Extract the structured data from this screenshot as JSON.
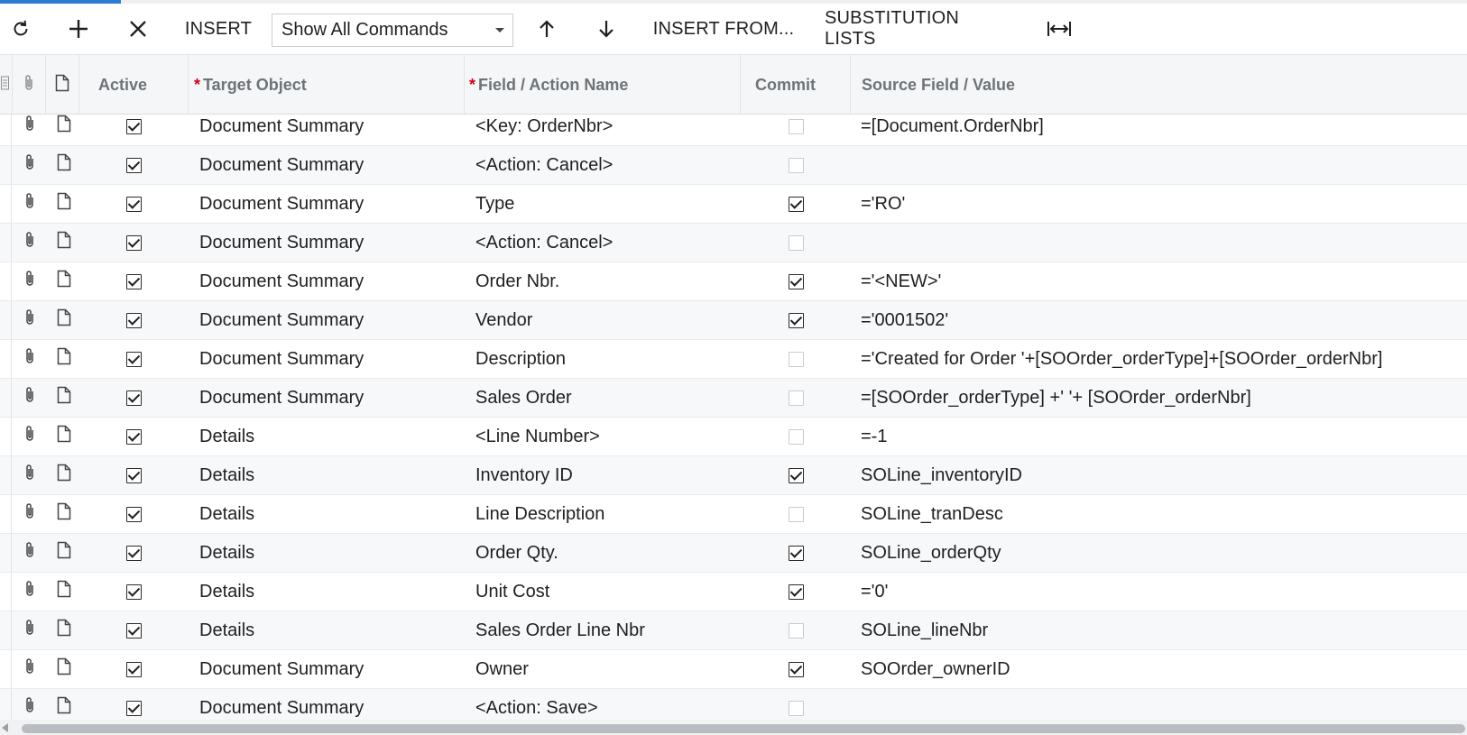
{
  "toolbar": {
    "refresh_icon": "refresh-icon",
    "add_icon": "plus-icon",
    "delete_icon": "close-icon",
    "insert_label": "INSERT",
    "commands_select_value": "Show All Commands",
    "move_up_icon": "arrow-up-icon",
    "move_down_icon": "arrow-down-icon",
    "insert_from_label": "INSERT FROM...",
    "substitution_lists_label": "SUBSTITUTION LISTS",
    "fit_columns_icon": "fit-columns-icon"
  },
  "columns": {
    "active": "Active",
    "target_object": "Target Object",
    "field_action": "Field / Action Name",
    "commit": "Commit",
    "source": "Source Field / Value",
    "required_mark": "*"
  },
  "rows": [
    {
      "active": true,
      "target": "Document Summary",
      "field": "<Key: OrderNbr>",
      "commit": false,
      "source": "=[Document.OrderNbr]"
    },
    {
      "active": true,
      "target": "Document Summary",
      "field": "<Action: Cancel>",
      "commit": false,
      "source": ""
    },
    {
      "active": true,
      "target": "Document Summary",
      "field": "Type",
      "commit": true,
      "source": "='RO'"
    },
    {
      "active": true,
      "target": "Document Summary",
      "field": "<Action: Cancel>",
      "commit": false,
      "source": ""
    },
    {
      "active": true,
      "target": "Document Summary",
      "field": "Order Nbr.",
      "commit": true,
      "source": "='<NEW>'"
    },
    {
      "active": true,
      "target": "Document Summary",
      "field": "Vendor",
      "commit": true,
      "source": "='0001502'"
    },
    {
      "active": true,
      "target": "Document Summary",
      "field": "Description",
      "commit": false,
      "source": "='Created for Order '+[SOOrder_orderType]+[SOOrder_orderNbr]"
    },
    {
      "active": true,
      "target": "Document Summary",
      "field": "Sales Order",
      "commit": false,
      "source": "=[SOOrder_orderType] +' '+ [SOOrder_orderNbr]"
    },
    {
      "active": true,
      "target": "Details",
      "field": "<Line Number>",
      "commit": false,
      "source": "=-1"
    },
    {
      "active": true,
      "target": "Details",
      "field": "Inventory ID",
      "commit": true,
      "source": "SOLine_inventoryID"
    },
    {
      "active": true,
      "target": "Details",
      "field": "Line Description",
      "commit": false,
      "source": "SOLine_tranDesc"
    },
    {
      "active": true,
      "target": "Details",
      "field": "Order Qty.",
      "commit": true,
      "source": "SOLine_orderQty"
    },
    {
      "active": true,
      "target": "Details",
      "field": "Unit Cost",
      "commit": true,
      "source": "='0'"
    },
    {
      "active": true,
      "target": "Details",
      "field": "Sales Order Line Nbr",
      "commit": false,
      "source": "SOLine_lineNbr"
    },
    {
      "active": true,
      "target": "Document Summary",
      "field": "Owner",
      "commit": true,
      "source": "SOOrder_ownerID"
    },
    {
      "active": true,
      "target": "Document Summary",
      "field": "<Action: Save>",
      "commit": false,
      "source": ""
    }
  ],
  "colors": {
    "accent": "#2e7bd6",
    "required": "#d0021b",
    "header_text": "#6d7378"
  }
}
